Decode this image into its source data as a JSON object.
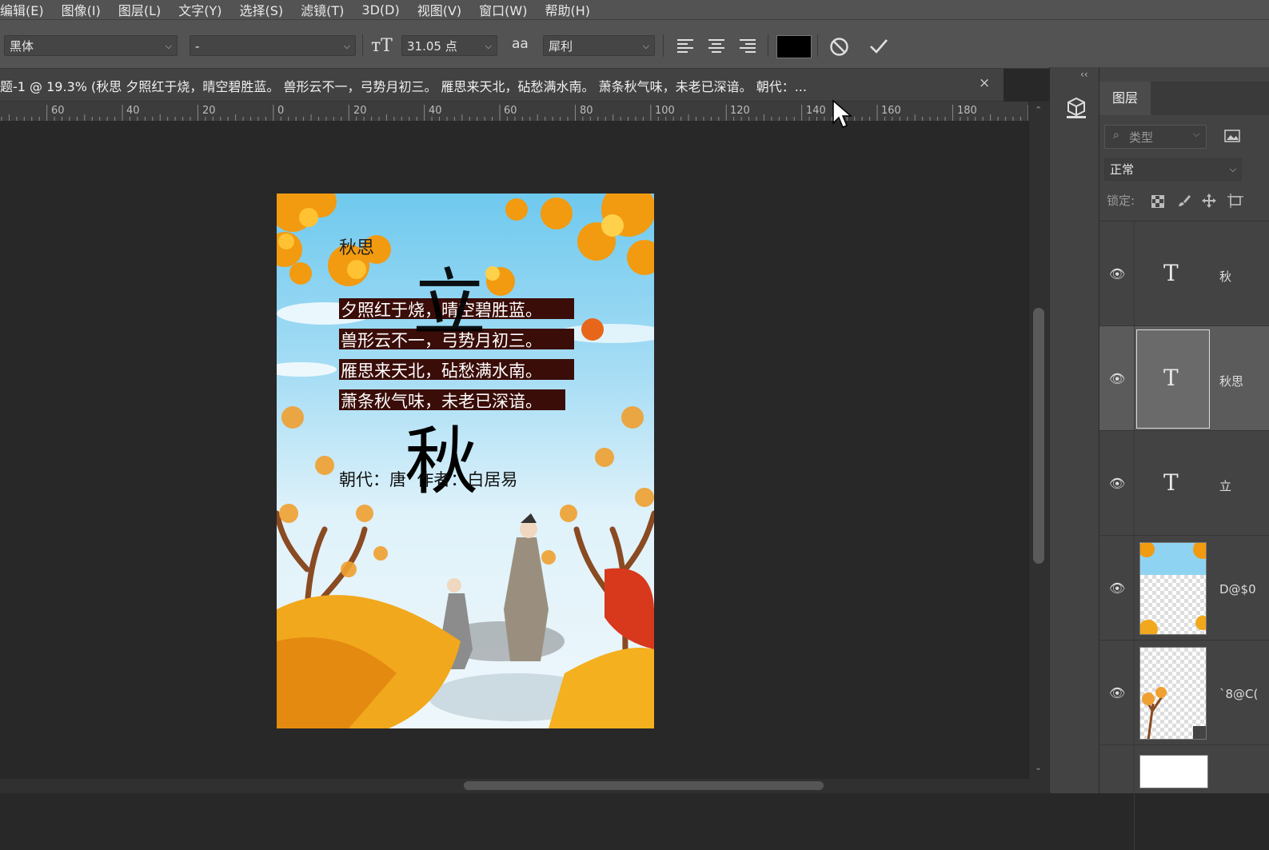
{
  "menu": [
    "编辑(E)",
    "图像(I)",
    "图层(L)",
    "文字(Y)",
    "选择(S)",
    "滤镜(T)",
    "3D(D)",
    "视图(V)",
    "窗口(W)",
    "帮助(H)"
  ],
  "options": {
    "font_family": "黑体",
    "font_style": "-",
    "font_size": "31.05 点",
    "antialias_icon": "aa",
    "antialias": "犀利",
    "color": "#000000"
  },
  "document": {
    "tab_title": "未标题-1 @ 19.3% (秋思 夕照红于烧，晴空碧胜蓝。 兽形云不一，弓势月初三。 雁思来天北，砧愁满水南。 萧条秋气味，未老已深谙。 朝代：...",
    "close": "×"
  },
  "ruler": [
    "60",
    "40",
    "20",
    "0",
    "20",
    "40",
    "60",
    "80",
    "100",
    "120",
    "140",
    "160",
    "180"
  ],
  "poster": {
    "title": "秋思",
    "lines": [
      "夕照红于烧，晴空碧胜蓝。",
      "兽形云不一，弓势月初三。",
      "雁思来天北，砧愁满水南。",
      "萧条秋气味，未老已深谙。"
    ],
    "big_char_top": "立",
    "big_char": "秋",
    "author_line": "朝代：唐  作者：白居易"
  },
  "layers_panel": {
    "tab": "图层",
    "filter_placeholder": "类型",
    "blend_mode": "正常",
    "lock_label": "锁定:",
    "layers": [
      {
        "type": "text",
        "name": "秋",
        "selected": false
      },
      {
        "type": "text",
        "name": "秋思",
        "selected": true
      },
      {
        "type": "text",
        "name": "立",
        "selected": false
      },
      {
        "type": "image",
        "name": "D@$0"
      },
      {
        "type": "image",
        "name": "`8@C("
      }
    ]
  }
}
